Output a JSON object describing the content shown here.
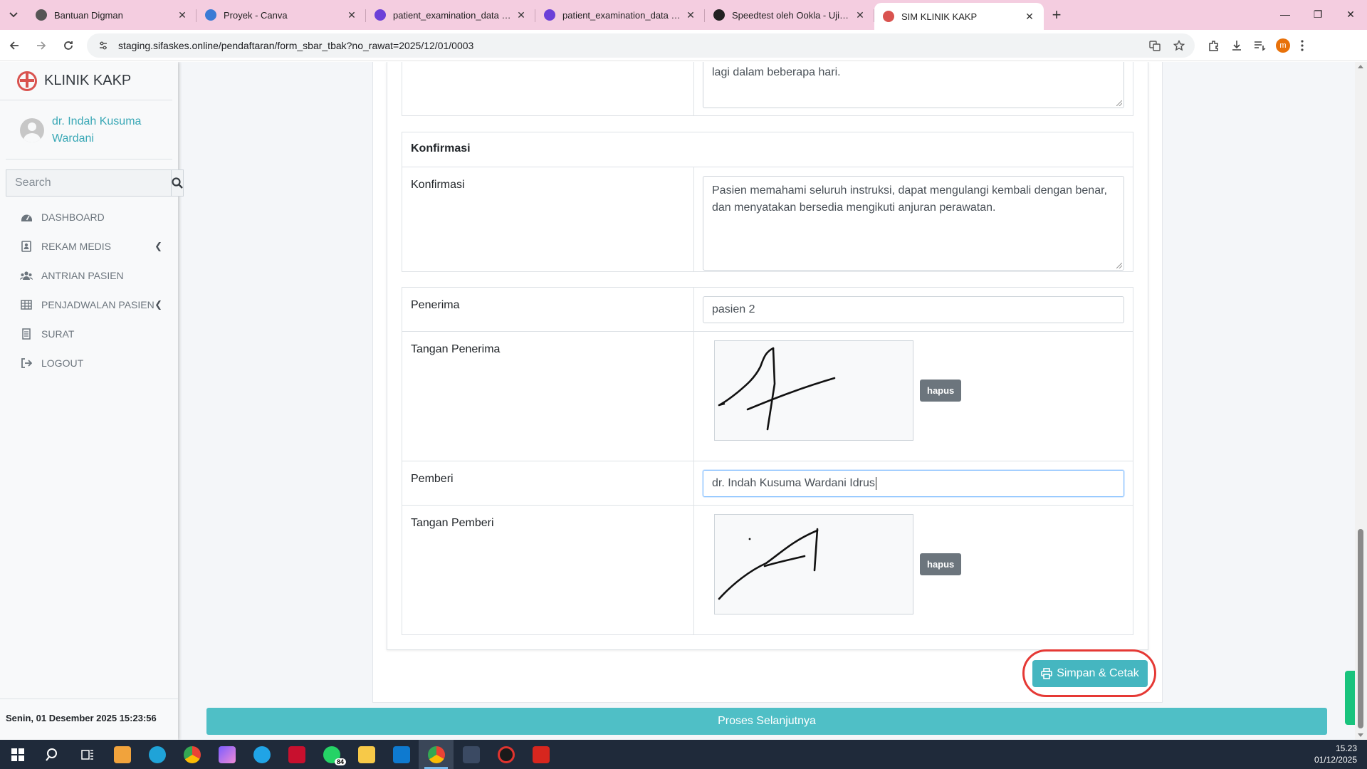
{
  "browser": {
    "tabs": [
      {
        "title": "Bantuan Digman",
        "favicon_color": "#555555",
        "active": false
      },
      {
        "title": "Proyek - Canva",
        "favicon_color": "#3a7bd5",
        "active": false
      },
      {
        "title": "patient_examination_data - Pre",
        "favicon_color": "#6b3fd8",
        "active": false
      },
      {
        "title": "patient_examination_data - Pre",
        "favicon_color": "#6b3fd8",
        "active": false
      },
      {
        "title": "Speedtest oleh Ookla - Uji Kece",
        "favicon_color": "#222222",
        "active": false
      },
      {
        "title": "SIM KLINIK KAKP",
        "favicon_color": "#d9534f",
        "active": true
      }
    ],
    "url": "staging.sifaskes.online/pendaftaran/form_sbar_tbak?no_rawat=2025/12/01/0003",
    "profile_initial": "m"
  },
  "sidebar": {
    "brand": "KLINIK KAKP",
    "user_name": "dr. Indah Kusuma Wardani",
    "search_placeholder": "Search",
    "nav": [
      {
        "label": "DASHBOARD",
        "icon": "dashboard-icon",
        "has_caret": false
      },
      {
        "label": "REKAM MEDIS",
        "icon": "medical-record-icon",
        "has_caret": true
      },
      {
        "label": "ANTRIAN PASIEN",
        "icon": "queue-icon",
        "has_caret": false
      },
      {
        "label": "PENJADWALAN PASIEN",
        "icon": "schedule-icon",
        "has_caret": true
      },
      {
        "label": "SURAT",
        "icon": "letter-icon",
        "has_caret": false
      },
      {
        "label": "LOGOUT",
        "icon": "logout-icon",
        "has_caret": false
      }
    ],
    "datetime": "Senin, 01 Desember 2025 15:23:56"
  },
  "form": {
    "prev_textarea_tail": "lagi dalam beberapa hari.",
    "section_konfirmasi": "Konfirmasi",
    "konfirmasi_label": "Konfirmasi",
    "konfirmasi_value": "Pasien memahami seluruh instruksi, dapat mengulangi kembali dengan benar, dan menyatakan bersedia mengikuti anjuran perawatan.",
    "penerima_label": "Penerima",
    "penerima_value": "pasien 2",
    "tangan_penerima_label": "Tangan Penerima",
    "pemberi_label": "Pemberi",
    "pemberi_value": "dr. Indah Kusuma Wardani Idrus",
    "tangan_pemberi_label": "Tangan Pemberi",
    "hapus_label": "hapus"
  },
  "actions": {
    "save_print": "Simpan & Cetak",
    "proses": "Proses Selanjutnya"
  },
  "taskbar": {
    "whatsapp_badge": "84",
    "time": "15.23",
    "date": "01/12/2025"
  },
  "colors": {
    "accent": "#45b6c0",
    "highlight": "#e53935",
    "tab_bar": "#f4cde0"
  }
}
